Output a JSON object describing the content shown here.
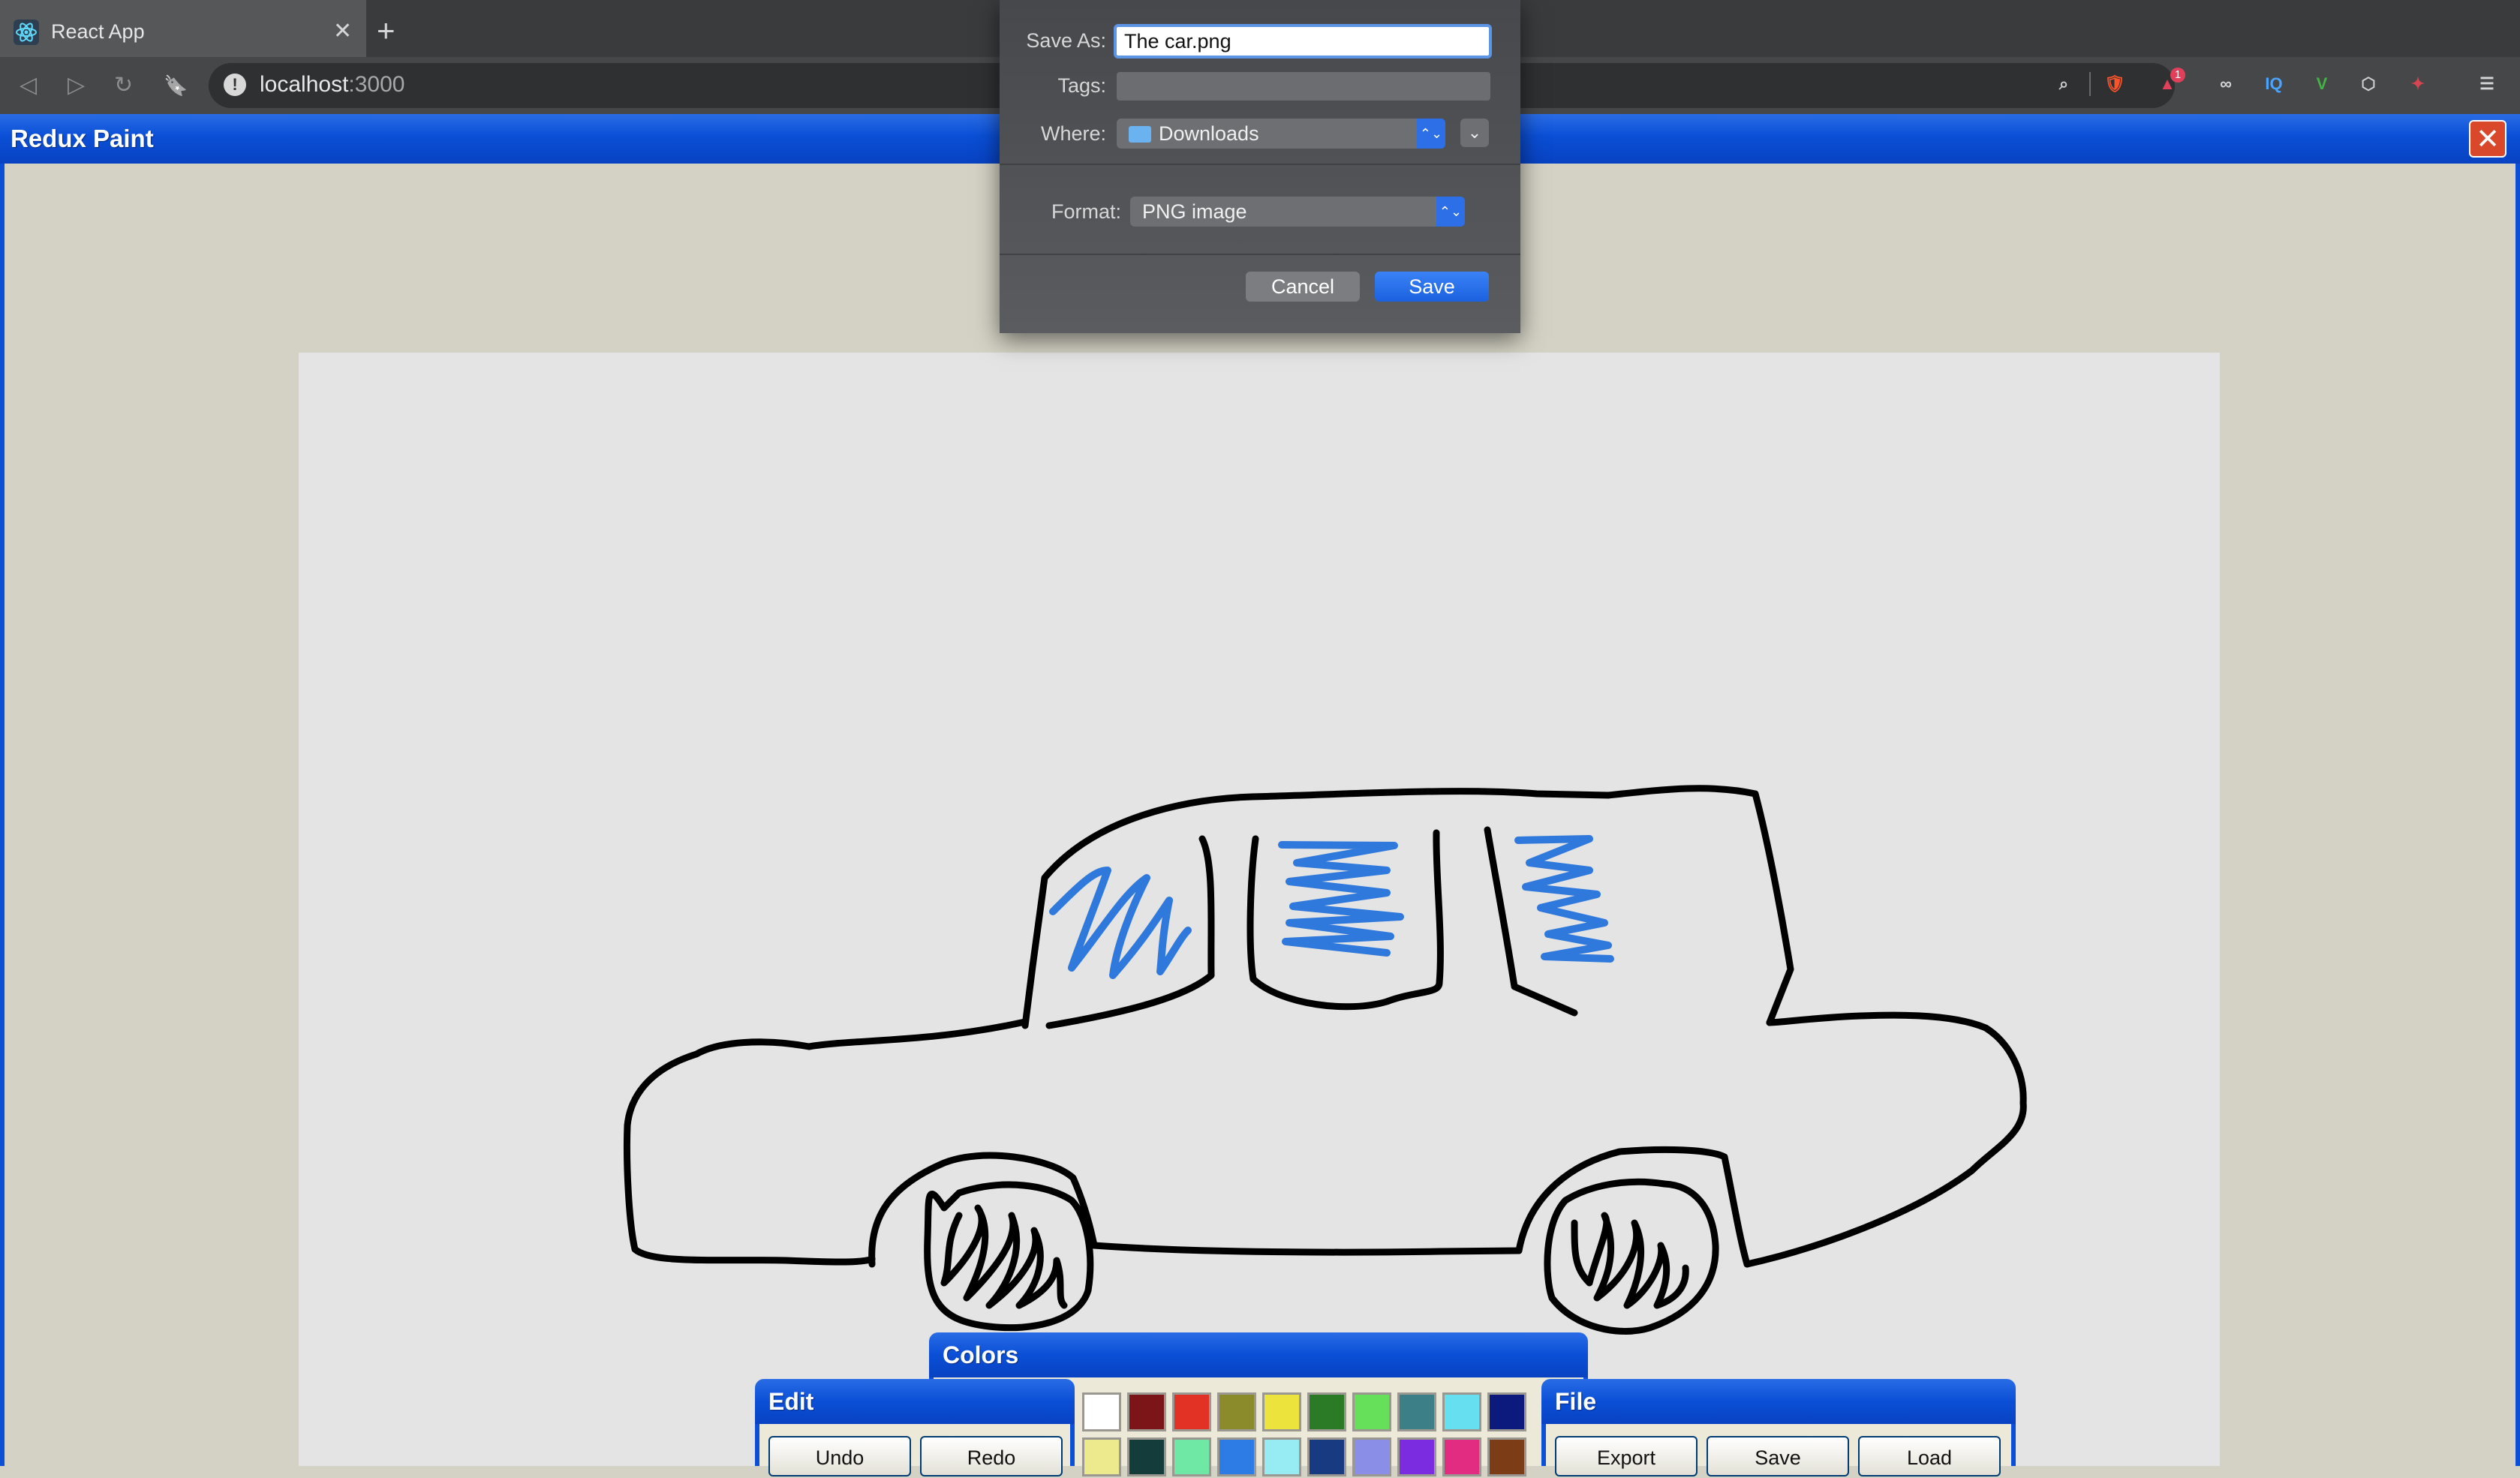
{
  "browser": {
    "tab_title": "React App",
    "close_tab_glyph": "✕",
    "new_tab_glyph": "+",
    "url_host": "localhost",
    "url_port": ":3000",
    "info_glyph": "!",
    "nav": {
      "back": "◁",
      "forward": "▷",
      "reload": "↻",
      "bookmark": "🔖"
    },
    "extensions": [
      {
        "name": "zoom-icon",
        "glyph": "⌕",
        "color": "#cfcfcf"
      },
      {
        "name": "brave-shield-icon",
        "glyph": "🛡",
        "color": "#fb542b"
      },
      {
        "name": "brave-rewards-icon",
        "glyph": "▲",
        "color": "#e0405a",
        "badge": "1"
      },
      {
        "name": "extension-glasses-icon",
        "glyph": "∞",
        "color": "#d6d6d6"
      },
      {
        "name": "extension-iq-icon",
        "glyph": "IQ",
        "color": "#4aa3ff"
      },
      {
        "name": "extension-v-icon",
        "glyph": "V",
        "color": "#43b343"
      },
      {
        "name": "extension-cube-icon",
        "glyph": "⬡",
        "color": "#cfcfcf"
      },
      {
        "name": "extension-gift-icon",
        "glyph": "✦",
        "color": "#d64550"
      },
      {
        "name": "menu-icon",
        "glyph": "☰",
        "color": "#d6d6d6"
      }
    ]
  },
  "app": {
    "title": "Redux Paint",
    "close_glyph": "✕"
  },
  "save_dialog": {
    "save_as_label": "Save As:",
    "save_as_value": "The car.png",
    "tags_label": "Tags:",
    "tags_value": "",
    "where_label": "Where:",
    "where_value": "Downloads",
    "format_label": "Format:",
    "format_value": "PNG image",
    "popup_arrows": "⌃⌄",
    "expand_glyph": "⌄",
    "cancel_label": "Cancel",
    "save_label": "Save"
  },
  "panels": {
    "colors_title": "Colors",
    "edit_title": "Edit",
    "file_title": "File",
    "edit_buttons": [
      "Undo",
      "Redo"
    ],
    "file_buttons": [
      "Export",
      "Save",
      "Load"
    ],
    "swatches_row1": [
      "#ffffff",
      "#7b1518",
      "#e23125",
      "#8b8b2b",
      "#ece33c",
      "#2a7a26",
      "#66e05a",
      "#3d7f87",
      "#66e0f0",
      "#0c1a7d"
    ],
    "swatches_row2": [
      "#ecea8c",
      "#133c3a",
      "#6ee8a4",
      "#2d7ce6",
      "#96ecf2",
      "#173a80",
      "#8a8ee6",
      "#7b2ce0",
      "#e22c82",
      "#7b3c16"
    ]
  },
  "drawing_colors": {
    "outline": "#000000",
    "fill_strokes": "#2f78dc"
  }
}
